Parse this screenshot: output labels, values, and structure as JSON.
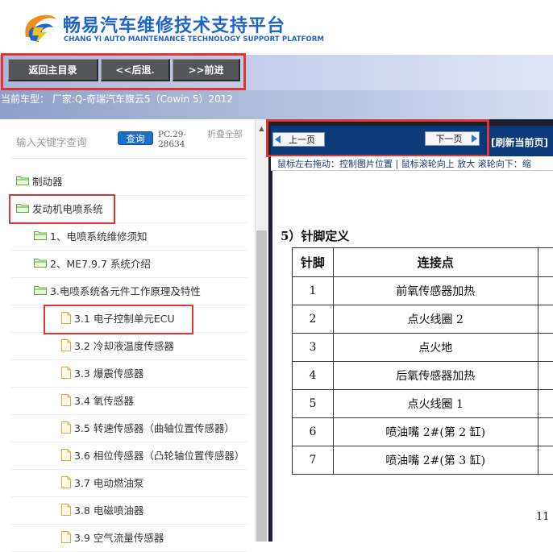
{
  "header": {
    "title_cn": "畅易汽车维修技术支持平台",
    "title_en": "CHANG YI AUTO MAINTENANCE TECHNOLOGY SUPPORT PLATFORM"
  },
  "nav": {
    "home_label": "返回主目录",
    "back_label": "<<后退.",
    "forward_label": ">>前进"
  },
  "car_info": "当前车型： 厂家:Q-奇瑞汽车旗云5（Cowin 5）2012",
  "sidebar": {
    "search_placeholder": "输入关键字查询",
    "query_label": "查询",
    "pc_code": "PC.29-28634",
    "collapse_label": "折叠全部",
    "items": [
      {
        "label": "制动器",
        "level": 0,
        "type": "folder"
      },
      {
        "label": "发动机电喷系统",
        "level": 0,
        "type": "folder"
      },
      {
        "label": "1、电喷系统维修须知",
        "level": 1,
        "type": "folder"
      },
      {
        "label": "2、ME7.9.7 系统介绍",
        "level": 1,
        "type": "folder"
      },
      {
        "label": "3.电喷系统各元件工作原理及特性",
        "level": 1,
        "type": "folder"
      },
      {
        "label": "3.1 电子控制单元ECU",
        "level": 2,
        "type": "file"
      },
      {
        "label": "3.2 冷却液温度传感器",
        "level": 2,
        "type": "file"
      },
      {
        "label": "3.3 爆震传感器",
        "level": 2,
        "type": "file"
      },
      {
        "label": "3.4 氧传感器",
        "level": 2,
        "type": "file"
      },
      {
        "label": "3.5 转速传感器（曲轴位置传感器）",
        "level": 2,
        "type": "file"
      },
      {
        "label": "3.6 相位传感器（凸轮轴位置传感器）",
        "level": 2,
        "type": "file"
      },
      {
        "label": "3.7 电动燃油泵",
        "level": 2,
        "type": "file"
      },
      {
        "label": "3.8 电磁喷油器",
        "level": 2,
        "type": "file"
      },
      {
        "label": "3.9 空气流量传感器",
        "level": 2,
        "type": "file"
      }
    ]
  },
  "viewer": {
    "prev_label": "上一页",
    "next_label": "下一页",
    "refresh_label": "[刷新当前页]",
    "hint": "鼠标左右拖动：控制图片位置 | 鼠标滚轮向上 放大  滚轮向下：缩",
    "heading": "5）针脚定义",
    "table": {
      "headers": [
        "针脚",
        "连接点"
      ],
      "rows": [
        [
          "1",
          "前氧传感器加热"
        ],
        [
          "2",
          "点火线圈 2"
        ],
        [
          "3",
          "点火地"
        ],
        [
          "4",
          "后氧传感器加热"
        ],
        [
          "5",
          "点火线圈 1"
        ],
        [
          "6",
          "喷油嘴 2#(第 2 缸)"
        ],
        [
          "7",
          "喷油嘴 2#(第 3 缸)"
        ]
      ]
    },
    "page_number": "11"
  },
  "colors": {
    "brand_blue": "#1f64c8",
    "highlight_red": "#e03535",
    "folder_green": "#5aa83a",
    "file_orange": "#e8a040"
  }
}
